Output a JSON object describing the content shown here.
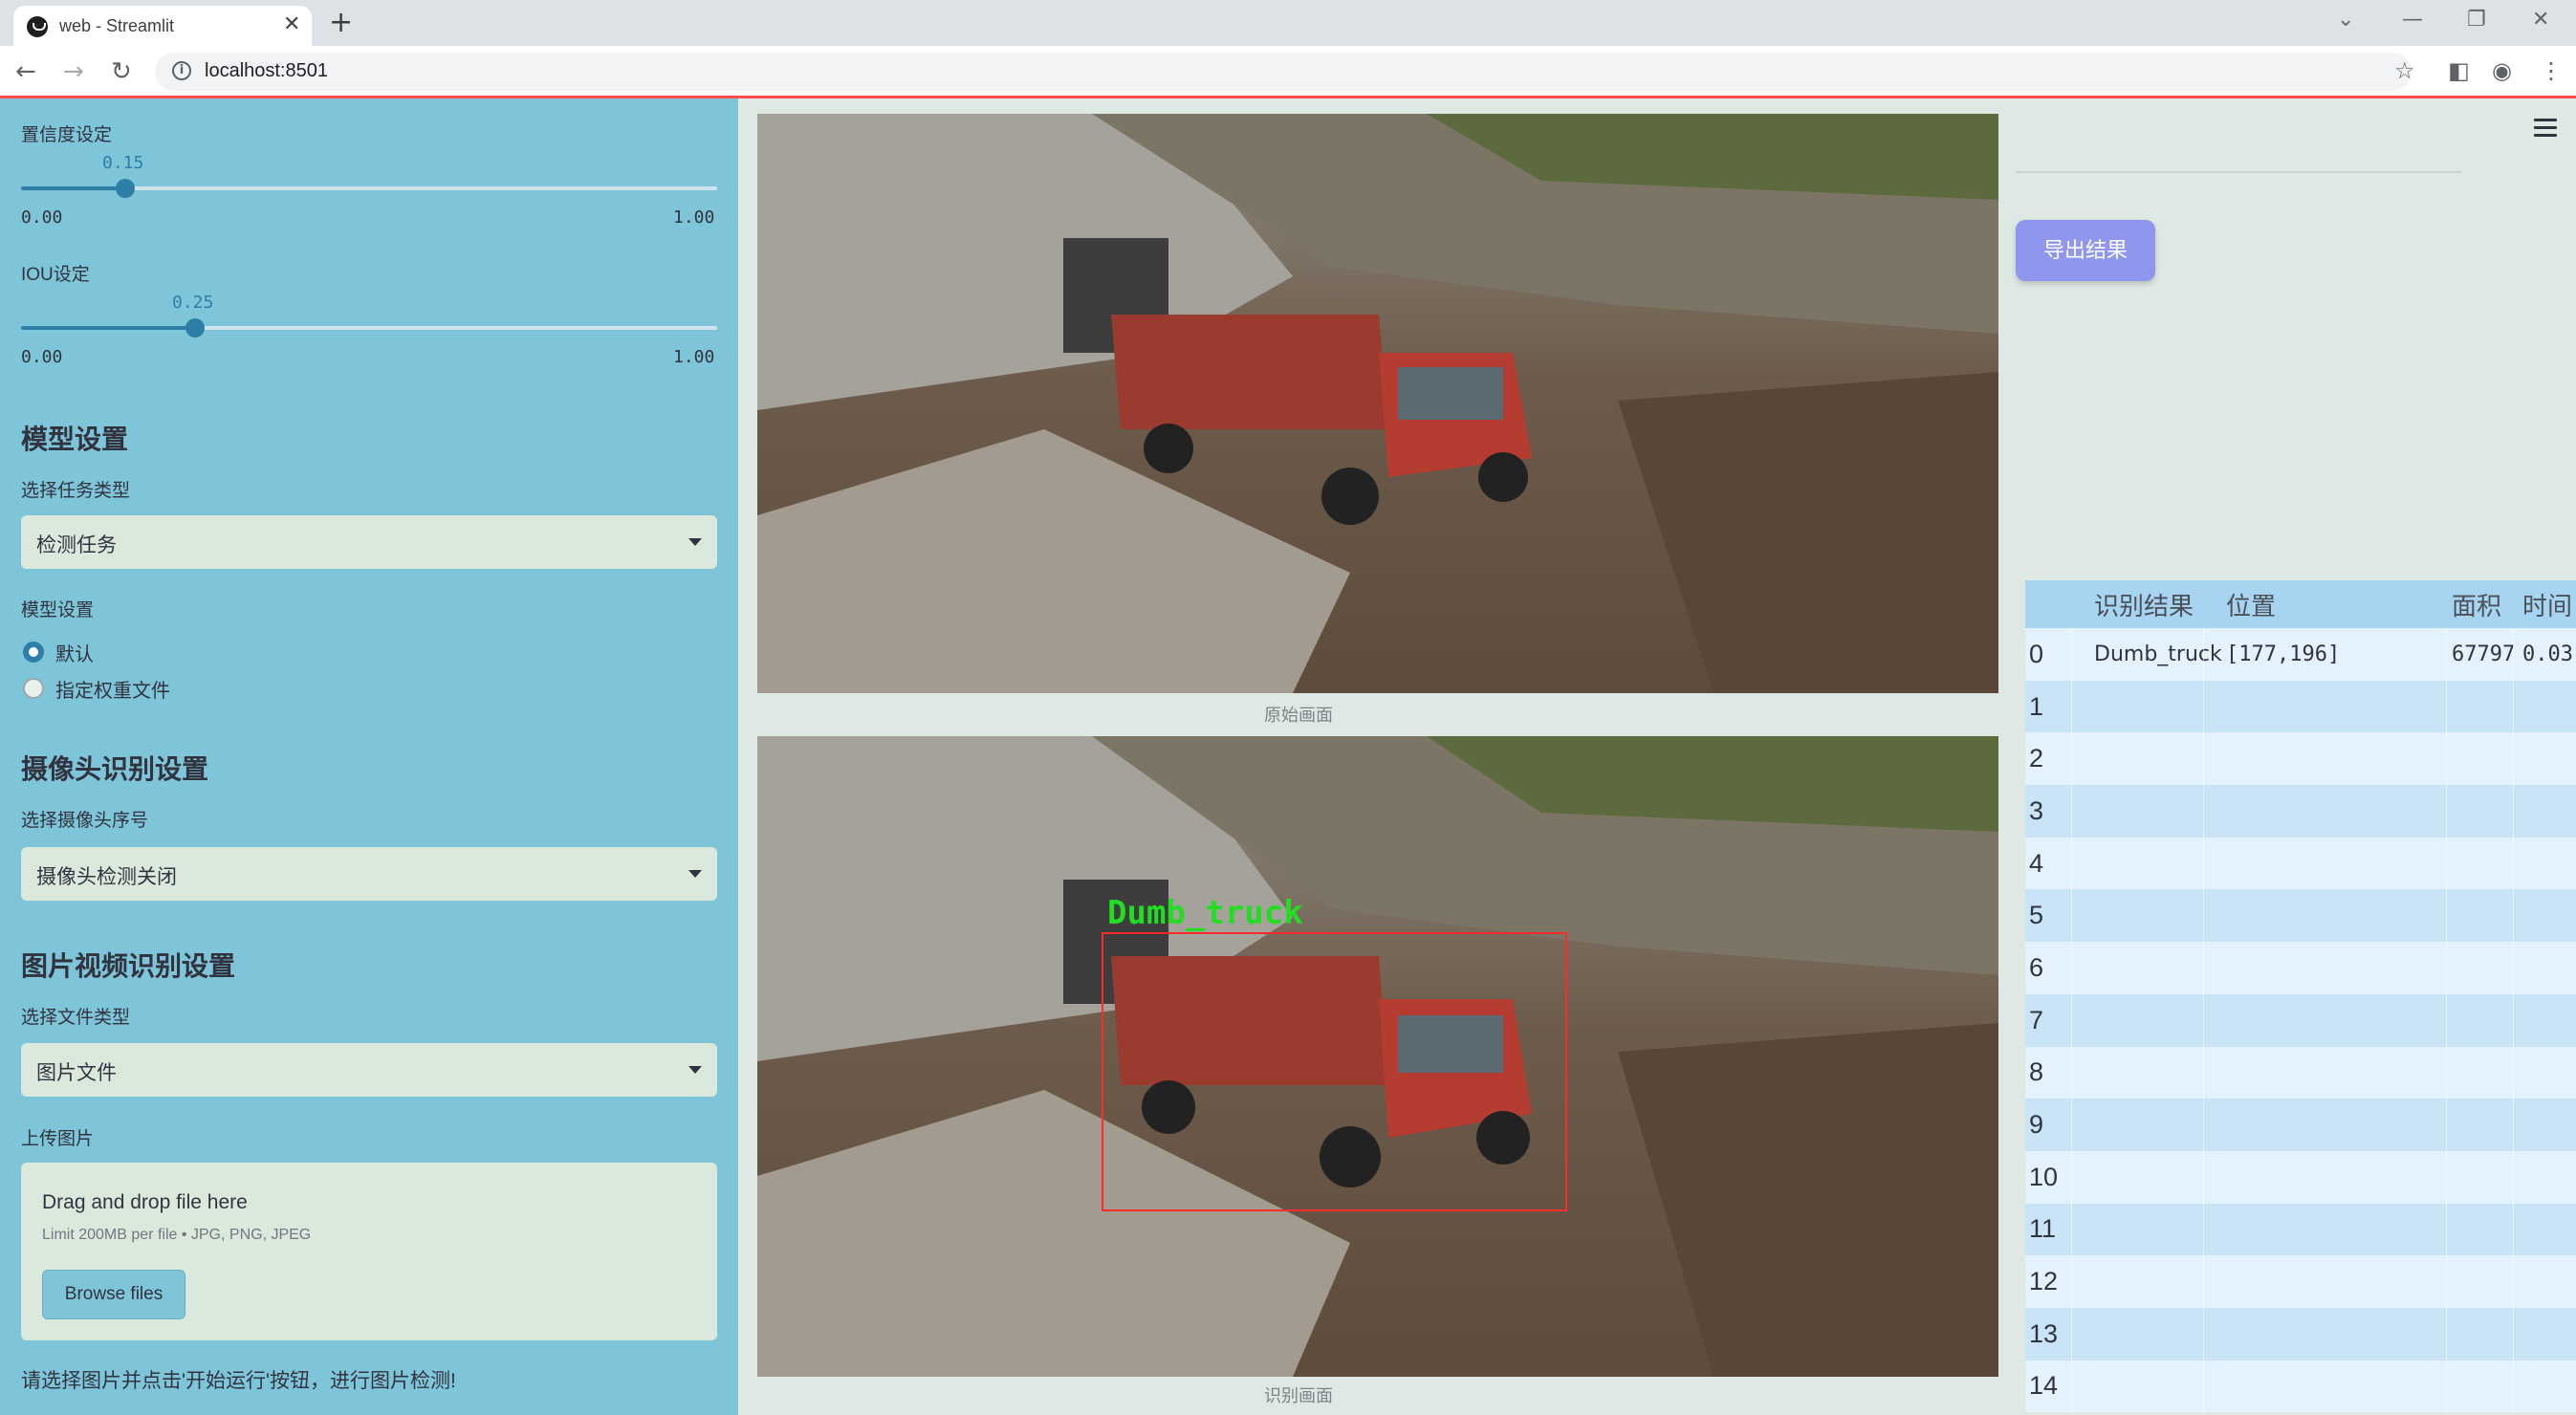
{
  "browser": {
    "tab_title": "web - Streamlit",
    "url": "localhost:8501"
  },
  "sidebar": {
    "confidence": {
      "label": "置信度设定",
      "value": "0.15",
      "min": "0.00",
      "max": "1.00",
      "fraction": 0.15
    },
    "iou": {
      "label": "IOU设定",
      "value": "0.25",
      "min": "0.00",
      "max": "1.00",
      "fraction": 0.25
    },
    "model_section": {
      "heading": "模型设置",
      "task_label": "选择任务类型",
      "task_value": "检测任务",
      "model_label": "模型设置",
      "options": [
        {
          "label": "默认",
          "selected": true
        },
        {
          "label": "指定权重文件",
          "selected": false
        }
      ]
    },
    "camera_section": {
      "heading": "摄像头识别设置",
      "camera_label": "选择摄像头序号",
      "camera_value": "摄像头检测关闭"
    },
    "media_section": {
      "heading": "图片视频识别设置",
      "filetype_label": "选择文件类型",
      "filetype_value": "图片文件",
      "upload_label": "上传图片",
      "drop_title": "Drag and drop file here",
      "drop_limit": "Limit 200MB per file • JPG, PNG, JPEG",
      "browse_label": "Browse files"
    },
    "hint": "请选择图片并点击'开始运行'按钮，进行图片检测!"
  },
  "main": {
    "original_caption": "原始画面",
    "result_caption": "识别画面",
    "detection_label": "Dumb_truck",
    "detection_color": "#ff2b2b",
    "label_color": "#22dd22"
  },
  "right": {
    "export_label": "导出结果",
    "table": {
      "columns": [
        "",
        "识别结果",
        "位置",
        "面积",
        "时间"
      ],
      "rows": [
        {
          "idx": "0",
          "result": "Dumb_truck",
          "pos": "[177,196]",
          "area": "67797",
          "time": "0.03"
        },
        {
          "idx": "1",
          "result": "",
          "pos": "",
          "area": "",
          "time": ""
        },
        {
          "idx": "2",
          "result": "",
          "pos": "",
          "area": "",
          "time": ""
        },
        {
          "idx": "3",
          "result": "",
          "pos": "",
          "area": "",
          "time": ""
        },
        {
          "idx": "4",
          "result": "",
          "pos": "",
          "area": "",
          "time": ""
        },
        {
          "idx": "5",
          "result": "",
          "pos": "",
          "area": "",
          "time": ""
        },
        {
          "idx": "6",
          "result": "",
          "pos": "",
          "area": "",
          "time": ""
        },
        {
          "idx": "7",
          "result": "",
          "pos": "",
          "area": "",
          "time": ""
        },
        {
          "idx": "8",
          "result": "",
          "pos": "",
          "area": "",
          "time": ""
        },
        {
          "idx": "9",
          "result": "",
          "pos": "",
          "area": "",
          "time": ""
        },
        {
          "idx": "10",
          "result": "",
          "pos": "",
          "area": "",
          "time": ""
        },
        {
          "idx": "11",
          "result": "",
          "pos": "",
          "area": "",
          "time": ""
        },
        {
          "idx": "12",
          "result": "",
          "pos": "",
          "area": "",
          "time": ""
        },
        {
          "idx": "13",
          "result": "",
          "pos": "",
          "area": "",
          "time": ""
        },
        {
          "idx": "14",
          "result": "",
          "pos": "",
          "area": "",
          "time": ""
        }
      ]
    }
  }
}
